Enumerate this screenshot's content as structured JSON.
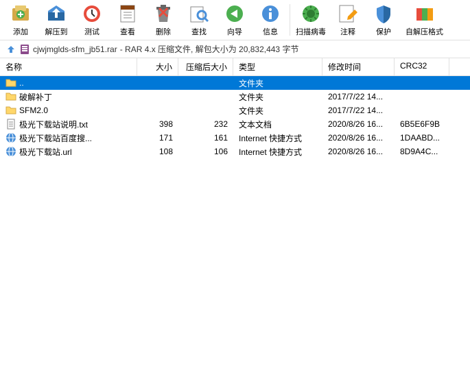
{
  "toolbar": [
    {
      "id": "add",
      "label": "添加"
    },
    {
      "id": "extract",
      "label": "解压到"
    },
    {
      "id": "test",
      "label": "测试"
    },
    {
      "id": "view",
      "label": "查看"
    },
    {
      "id": "delete",
      "label": "删除"
    },
    {
      "id": "find",
      "label": "查找"
    },
    {
      "id": "wizard",
      "label": "向导"
    },
    {
      "id": "info",
      "label": "信息"
    },
    {
      "id": "scan",
      "label": "扫描病毒"
    },
    {
      "id": "comment",
      "label": "注释"
    },
    {
      "id": "protect",
      "label": "保护"
    },
    {
      "id": "sfx",
      "label": "自解压格式"
    }
  ],
  "path": {
    "filename": "cjwjmglds-sfm_jb51.rar",
    "info": "- RAR 4.x 压缩文件, 解包大小为 20,832,443 字节"
  },
  "columns": {
    "name": "名称",
    "size": "大小",
    "csize": "压缩后大小",
    "type": "类型",
    "date": "修改时间",
    "crc": "CRC32"
  },
  "rows": [
    {
      "icon": "folder-up",
      "name": "..",
      "size": "",
      "csize": "",
      "type": "文件夹",
      "date": "",
      "crc": "",
      "selected": true
    },
    {
      "icon": "folder",
      "name": "破解补丁",
      "size": "",
      "csize": "",
      "type": "文件夹",
      "date": "2017/7/22 14...",
      "crc": ""
    },
    {
      "icon": "folder",
      "name": "SFM2.0",
      "size": "",
      "csize": "",
      "type": "文件夹",
      "date": "2017/7/22 14...",
      "crc": ""
    },
    {
      "icon": "txt",
      "name": "极光下载站说明.txt",
      "size": "398",
      "csize": "232",
      "type": "文本文档",
      "date": "2020/8/26 16...",
      "crc": "6B5E6F9B"
    },
    {
      "icon": "url",
      "name": "极光下载站百度搜...",
      "size": "171",
      "csize": "161",
      "type": "Internet 快捷方式",
      "date": "2020/8/26 16...",
      "crc": "1DAABD..."
    },
    {
      "icon": "url",
      "name": "极光下载站.url",
      "size": "108",
      "csize": "106",
      "type": "Internet 快捷方式",
      "date": "2020/8/26 16...",
      "crc": "8D9A4C..."
    }
  ]
}
